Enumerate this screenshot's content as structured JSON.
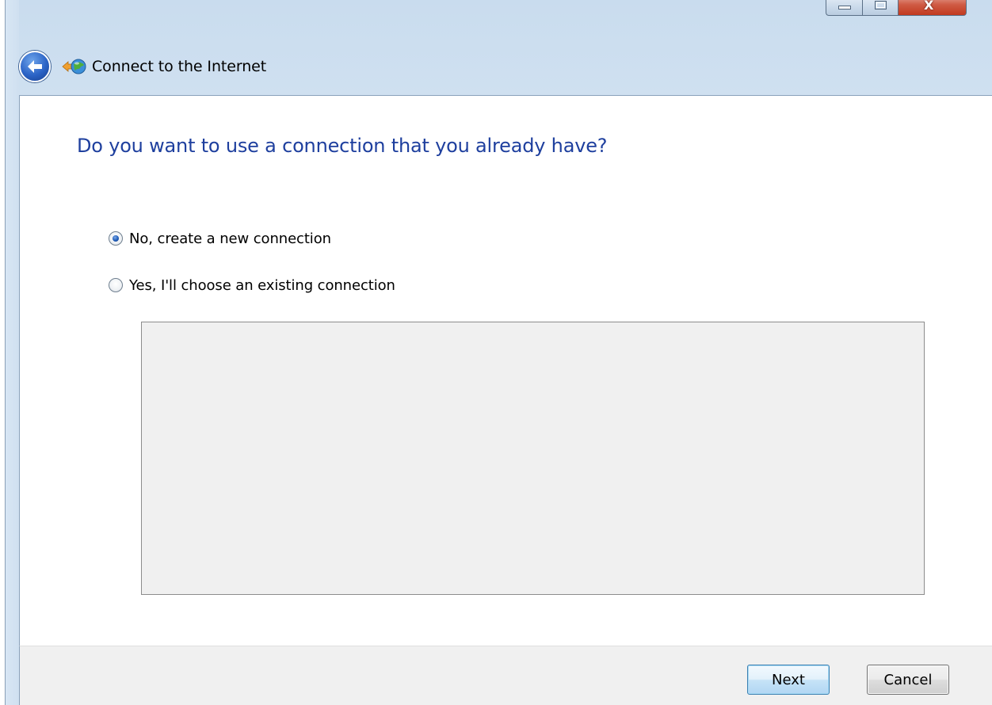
{
  "window": {
    "title": "Connect to the Internet",
    "caption_buttons": {
      "minimize_icon": "minimize-icon",
      "maximize_icon": "maximize-icon",
      "close_label": "X"
    }
  },
  "header": {
    "back_icon": "back-arrow-icon",
    "app_icon": "network-globe-icon"
  },
  "content": {
    "main_instruction": "Do you want to use a connection that you already have?",
    "options": [
      {
        "label": "No, create a new connection",
        "checked": true
      },
      {
        "label": "Yes, I'll choose an existing connection",
        "checked": false
      }
    ]
  },
  "footer": {
    "next_label": "Next",
    "cancel_label": "Cancel"
  },
  "colors": {
    "instruction_text": "#1e3f9e",
    "footer_bg": "#f0f0f0",
    "list_bg": "#f0f0f0"
  }
}
